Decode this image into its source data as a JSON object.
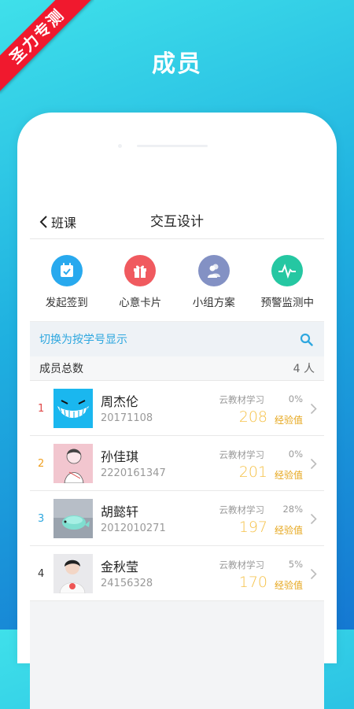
{
  "banner": {
    "ribbon_text": "圣力专测",
    "heading": "成员"
  },
  "navbar": {
    "back_label": "班课",
    "title": "交互设计"
  },
  "actions": [
    {
      "label": "发起签到",
      "icon": "calendar-check-icon",
      "color": "#28a9ee"
    },
    {
      "label": "心意卡片",
      "icon": "gift-icon",
      "color": "#f05a5f"
    },
    {
      "label": "小组方案",
      "icon": "group-icon",
      "color": "#8391c4"
    },
    {
      "label": "预警监测中",
      "icon": "pulse-icon",
      "color": "#25c7a2"
    }
  ],
  "search": {
    "label": "切换为按学号显示",
    "icon": "search-icon"
  },
  "member_count": {
    "label": "成员总数",
    "value": "4 人"
  },
  "members": [
    {
      "rank": "1",
      "rank_color": "#e04848",
      "name": "周杰伦",
      "id": "20171108",
      "category": "云教材学习",
      "percent": "0%",
      "exp": "208",
      "exp_label": "经验值"
    },
    {
      "rank": "2",
      "rank_color": "#f0a020",
      "name": "孙佳琪",
      "id": "2220161347",
      "category": "云教材学习",
      "percent": "0%",
      "exp": "201",
      "exp_label": "经验值"
    },
    {
      "rank": "3",
      "rank_color": "#2ea7df",
      "name": "胡懿轩",
      "id": "2012010271",
      "category": "云教材学习",
      "percent": "28%",
      "exp": "197",
      "exp_label": "经验值"
    },
    {
      "rank": "4",
      "rank_color": "#333333",
      "name": "金秋莹",
      "id": "24156328",
      "category": "云教材学习",
      "percent": "5%",
      "exp": "170",
      "exp_label": "经验值"
    }
  ],
  "colors": {
    "accent": "#2ea7df",
    "exp": "#f5c24a",
    "ribbon": "#f0192e"
  }
}
